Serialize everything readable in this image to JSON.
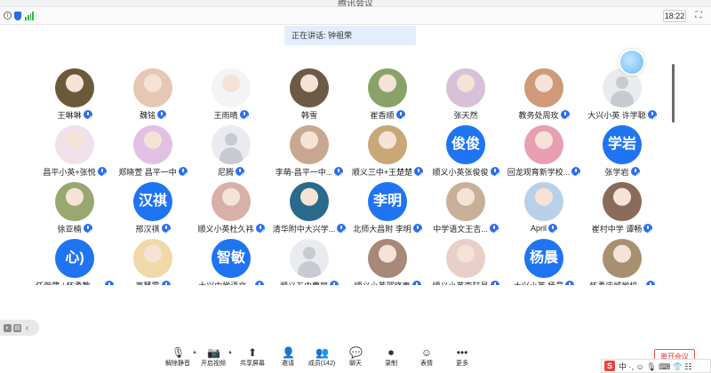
{
  "window": {
    "title": "腾讯会议"
  },
  "topbar": {
    "time": "18:22",
    "info_icon": "info-icon",
    "shield_icon": "shield-icon",
    "signal_icon": "signal-icon"
  },
  "speaking": {
    "text": "正在讲话: 钟祖荣"
  },
  "participants": [
    {
      "name": "王琳琳",
      "avatar": "photo",
      "color": "#6b5a3a"
    },
    {
      "name": "魏铭",
      "avatar": "photo",
      "color": "#e6c7b4"
    },
    {
      "name": "王雨晴",
      "avatar": "photo",
      "color": "#f4f4f4"
    },
    {
      "name": "韩雪",
      "avatar": "photo",
      "color": "#6d5a44",
      "muted_icon": false
    },
    {
      "name": "崔香顺",
      "avatar": "photo",
      "color": "#8aa26a"
    },
    {
      "name": "张天然",
      "avatar": "photo",
      "color": "#d8c0d8",
      "muted_icon": false
    },
    {
      "name": "教务处周玫",
      "avatar": "photo",
      "color": "#d09a7a"
    },
    {
      "name": "大兴小英 许学聪",
      "avatar": "person"
    },
    {
      "name": "昌平小英+张悦",
      "avatar": "photo",
      "color": "#f1e1ea"
    },
    {
      "name": "郑晓萱 昌平一中",
      "avatar": "photo",
      "color": "#e2c0e4"
    },
    {
      "name": "尼腾",
      "avatar": "person"
    },
    {
      "name": "李萌-昌平一中...",
      "avatar": "photo",
      "color": "#c8a890"
    },
    {
      "name": "顺义三中+王楚楚",
      "avatar": "photo",
      "color": "#c8a877"
    },
    {
      "name": "顺义小英张俊俊",
      "avatar": "text",
      "text": "俊俊"
    },
    {
      "name": "回龙观育新学校...",
      "avatar": "photo",
      "color": "#e8a0b0"
    },
    {
      "name": "张学岩",
      "avatar": "text",
      "text": "学岩"
    },
    {
      "name": "徐亚楠",
      "avatar": "photo",
      "color": "#98a870"
    },
    {
      "name": "邢汉祺",
      "avatar": "text",
      "text": "汉祺"
    },
    {
      "name": "顺义小英杜久祎",
      "avatar": "photo",
      "color": "#d8b0a8"
    },
    {
      "name": "清华附中大兴学...",
      "avatar": "photo",
      "color": "#2a6a8a"
    },
    {
      "name": "北师大昌附 李明",
      "avatar": "text",
      "text": "李明"
    },
    {
      "name": "中学语文王吉...",
      "avatar": "photo",
      "color": "#c8b098"
    },
    {
      "name": "April",
      "avatar": "photo",
      "color": "#b8d0e8"
    },
    {
      "name": "崔村中学 谭畅",
      "avatar": "photo",
      "color": "#8a6a5a"
    },
    {
      "name": "任瀚葳 / 怀柔教科...",
      "avatar": "text",
      "text": "心)"
    },
    {
      "name": "高慧霞",
      "avatar": "photo",
      "color": "#f0d8a8"
    },
    {
      "name": "大兴中学语文...",
      "avatar": "text",
      "text": "智敏"
    },
    {
      "name": "顺义五中曹丽",
      "avatar": "person"
    },
    {
      "name": "顺义小英邵晓惠",
      "avatar": "photo",
      "color": "#a88878"
    },
    {
      "name": "顺义小英李轩昊",
      "avatar": "photo",
      "color": "#e8d0c8"
    },
    {
      "name": "大兴小英 杨晨",
      "avatar": "text",
      "text": "杨晨"
    },
    {
      "name": "怀柔庙城学校...",
      "avatar": "photo",
      "color": "#a89070"
    }
  ],
  "toolbar": {
    "items": [
      {
        "label": "解除静音",
        "icon": "mic-muted-icon",
        "glyph": "🎙"
      },
      {
        "label": "开启视频",
        "icon": "video-off-icon",
        "glyph": "📷"
      },
      {
        "label": "共享屏幕",
        "icon": "share-screen-icon",
        "glyph": "⬆"
      },
      {
        "label": "邀请",
        "icon": "invite-icon",
        "glyph": "👤"
      },
      {
        "label": "成员(142)",
        "icon": "members-icon",
        "glyph": "👥"
      },
      {
        "label": "聊天",
        "icon": "chat-icon",
        "glyph": "💬"
      },
      {
        "label": "录制",
        "icon": "record-icon",
        "glyph": "⏺"
      },
      {
        "label": "表情",
        "icon": "emoji-icon",
        "glyph": "☺"
      },
      {
        "label": "更多",
        "icon": "more-icon",
        "glyph": "•••"
      }
    ],
    "end_label": "离开会议"
  },
  "ime": {
    "brand": "S",
    "text": "中 ·, ☺ 🎙 ⌨ 👕 ☷"
  }
}
